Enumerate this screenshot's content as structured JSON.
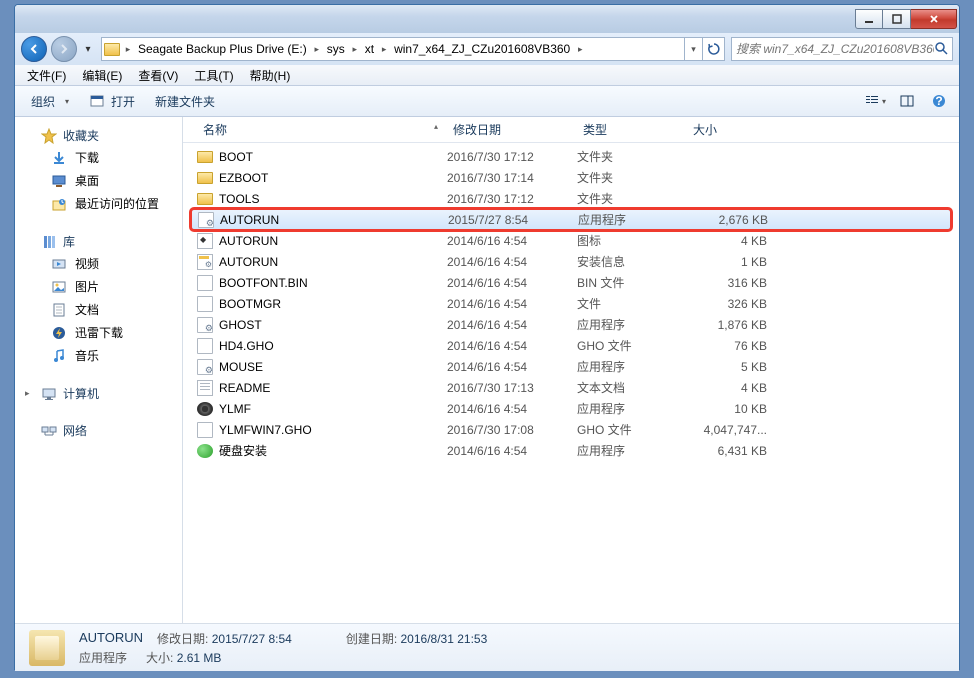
{
  "breadcrumb": [
    "Seagate Backup Plus Drive (E:)",
    "sys",
    "xt",
    "win7_x64_ZJ_CZu201608VB360"
  ],
  "search_placeholder": "搜索 win7_x64_ZJ_CZu201608VB360",
  "menus": {
    "file": "文件(F)",
    "edit": "编辑(E)",
    "view": "查看(V)",
    "tools": "工具(T)",
    "help": "帮助(H)"
  },
  "toolbar": {
    "organize": "组织",
    "open": "打开",
    "newfolder": "新建文件夹"
  },
  "sidebar": {
    "favorites": {
      "label": "收藏夹",
      "items": [
        "下载",
        "桌面",
        "最近访问的位置"
      ]
    },
    "libraries": {
      "label": "库",
      "items": [
        "视频",
        "图片",
        "文档",
        "迅雷下载",
        "音乐"
      ]
    },
    "computer": {
      "label": "计算机"
    },
    "network": {
      "label": "网络"
    }
  },
  "columns": {
    "name": "名称",
    "date": "修改日期",
    "type": "类型",
    "size": "大小"
  },
  "files": [
    {
      "name": "BOOT",
      "date": "2016/7/30 17:12",
      "type": "文件夹",
      "size": "",
      "icon": "folder"
    },
    {
      "name": "EZBOOT",
      "date": "2016/7/30 17:14",
      "type": "文件夹",
      "size": "",
      "icon": "folder"
    },
    {
      "name": "TOOLS",
      "date": "2016/7/30 17:12",
      "type": "文件夹",
      "size": "",
      "icon": "folder"
    },
    {
      "name": "AUTORUN",
      "date": "2015/7/27 8:54",
      "type": "应用程序",
      "size": "2,676 KB",
      "icon": "exe",
      "selected": true,
      "hilite": true
    },
    {
      "name": "AUTORUN",
      "date": "2014/6/16 4:54",
      "type": "图标",
      "size": "4 KB",
      "icon": "ico"
    },
    {
      "name": "AUTORUN",
      "date": "2014/6/16 4:54",
      "type": "安装信息",
      "size": "1 KB",
      "icon": "inf"
    },
    {
      "name": "BOOTFONT.BIN",
      "date": "2014/6/16 4:54",
      "type": "BIN 文件",
      "size": "316 KB",
      "icon": "bin"
    },
    {
      "name": "BOOTMGR",
      "date": "2014/6/16 4:54",
      "type": "文件",
      "size": "326 KB",
      "icon": "file"
    },
    {
      "name": "GHOST",
      "date": "2014/6/16 4:54",
      "type": "应用程序",
      "size": "1,876 KB",
      "icon": "exe"
    },
    {
      "name": "HD4.GHO",
      "date": "2014/6/16 4:54",
      "type": "GHO 文件",
      "size": "76 KB",
      "icon": "gho"
    },
    {
      "name": "MOUSE",
      "date": "2014/6/16 4:54",
      "type": "应用程序",
      "size": "5 KB",
      "icon": "exe"
    },
    {
      "name": "README",
      "date": "2016/7/30 17:13",
      "type": "文本文档",
      "size": "4 KB",
      "icon": "readme"
    },
    {
      "name": "YLMF",
      "date": "2014/6/16 4:54",
      "type": "应用程序",
      "size": "10 KB",
      "icon": "ylmf"
    },
    {
      "name": "YLMFWIN7.GHO",
      "date": "2016/7/30 17:08",
      "type": "GHO 文件",
      "size": "4,047,747...",
      "icon": "gho"
    },
    {
      "name": "硬盘安装",
      "date": "2014/6/16 4:54",
      "type": "应用程序",
      "size": "6,431 KB",
      "icon": "green"
    }
  ],
  "details": {
    "name": "AUTORUN",
    "type": "应用程序",
    "mod_label": "修改日期:",
    "mod": "2015/7/27 8:54",
    "size_label": "大小:",
    "size": "2.61 MB",
    "created_label": "创建日期:",
    "created": "2016/8/31 21:53"
  }
}
